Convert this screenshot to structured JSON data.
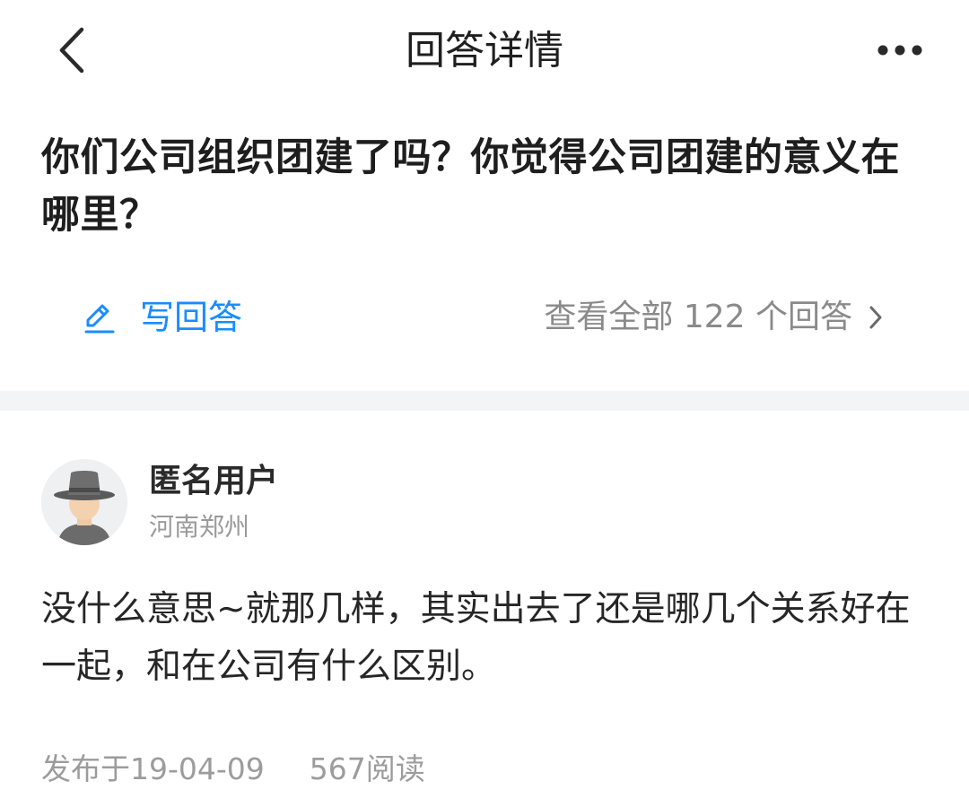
{
  "nav": {
    "title": "回答详情",
    "back_icon": "chevron-left-icon",
    "more_icon": "more-horizontal-icon"
  },
  "question": {
    "title": "你们公司组织团建了吗？你觉得公司团建的意义在哪里？"
  },
  "actions": {
    "write_label": "写回答",
    "write_icon": "pen-icon",
    "view_all_label": "查看全部 122 个回答",
    "view_all_icon": "chevron-right-icon"
  },
  "answer": {
    "user_name": "匿名用户",
    "location": "河南郑州",
    "avatar_icon": "anonymous-hat-avatar",
    "text": "没什么意思~就那几样，其实出去了还是哪几个关系好在一起，和在公司有什么区别。",
    "published": "发布于19-04-09",
    "reads": "567阅读"
  },
  "colors": {
    "accent": "#1a8cff",
    "muted_text": "#9c9c9c",
    "divider": "#f3f4f6"
  }
}
